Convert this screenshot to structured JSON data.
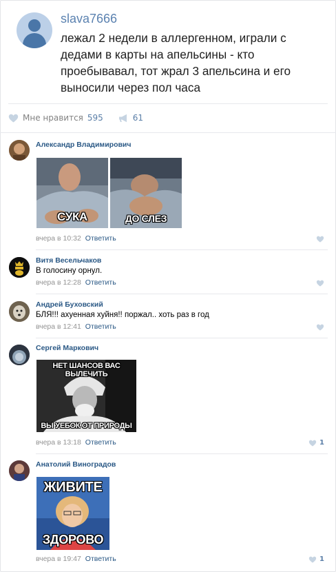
{
  "post": {
    "author": "slava7666",
    "text": "лежал 2 недели в аллергенном, играли с дедами в карты на апельсины - кто проебывавал, тот жрал 3 апельсина и его выносили через пол часа",
    "likes_label": "Мне нравится",
    "likes_count": "595",
    "reposts_count": "61"
  },
  "comments": [
    {
      "author": "Александр Владимирович",
      "time": "вчера в 10:32",
      "reply": "Ответить",
      "memes": [
        {
          "caption": "СУКА"
        },
        {
          "caption": "ДО СЛЕЗ"
        }
      ]
    },
    {
      "author": "Витя Весельчаков",
      "text": "В голосину орнул.",
      "time": "вчера в 12:28",
      "reply": "Ответить"
    },
    {
      "author": "Андрей Буховский",
      "text": "БЛЯ!!! ахуенная хуйня!! поржал.. хоть раз в год",
      "time": "вчера в 12:41",
      "reply": "Ответить"
    },
    {
      "author": "Сергей Маркович",
      "time": "вчера в 13:18",
      "reply": "Ответить",
      "likes": "1",
      "meme_top": "НЕТ ШАНСОВ ВАС ВЫЛЕЧИТЬ",
      "meme_bottom": "ВЫ  УЕБОК ОТ ПРИРОДЫ"
    },
    {
      "author": "Анатолий Виноградов",
      "time": "вчера в 19:47",
      "reply": "Ответить",
      "likes": "1",
      "meme_top": "ЖИВИТЕ",
      "meme_bottom": "ЗДОРОВО"
    }
  ],
  "colors": {
    "link": "#2a5885",
    "accent": "#5a7ea7",
    "meta": "#939393",
    "divider": "#e7e8ec"
  }
}
